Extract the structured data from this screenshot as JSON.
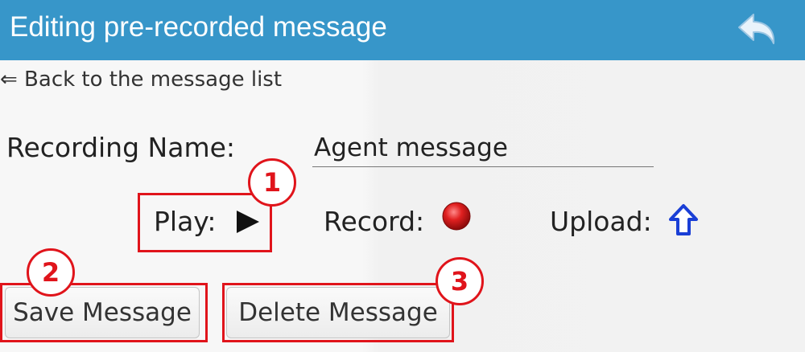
{
  "window": {
    "title": "Editing pre-recorded message",
    "back_icon": "undo-arrow-icon"
  },
  "nav": {
    "back_link": "⇐ Back to the message list"
  },
  "form": {
    "recording_name_label": "Recording Name:",
    "recording_name_value": "Agent message"
  },
  "controls": {
    "play_label": "Play:",
    "play_icon": "play-triangle-icon",
    "record_label": "Record:",
    "record_icon": "red-record-dot-icon",
    "upload_label": "Upload:",
    "upload_icon": "up-arrow-icon"
  },
  "buttons": {
    "save_label": "Save Message",
    "delete_label": "Delete Message"
  },
  "annotations": {
    "callout_1": "1",
    "callout_2": "2",
    "callout_3": "3"
  },
  "colors": {
    "titlebar": "#3796c9",
    "annotation_red": "#e0141b",
    "record_red": "#e02020",
    "upload_blue": "#1a3fd6"
  }
}
